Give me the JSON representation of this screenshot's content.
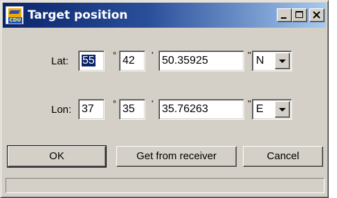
{
  "window": {
    "title": "Target position",
    "app_icon": "cdu-app-icon",
    "app_icon_text": "CDU",
    "controls": [
      "minimize-icon",
      "maximize-icon",
      "close-icon"
    ]
  },
  "lat": {
    "label": "Lat:",
    "degrees": "55",
    "degree_symbol": "°",
    "minutes": "42",
    "minute_symbol": "'",
    "seconds": "50.35925",
    "second_symbol": "\"",
    "hemisphere": "N"
  },
  "lon": {
    "label": "Lon:",
    "degrees": "37",
    "degree_symbol": "°",
    "minutes": "35",
    "minute_symbol": "'",
    "seconds": "35.76263",
    "second_symbol": "\"",
    "hemisphere": "E"
  },
  "buttons": {
    "ok": "OK",
    "get_from_receiver": "Get from receiver",
    "cancel": "Cancel"
  },
  "status": {
    "text": ""
  },
  "colors": {
    "titlebar_start": "#0a246a",
    "titlebar_end": "#a6caf0",
    "face": "#d4d0c8",
    "selection": "#0a246a"
  }
}
